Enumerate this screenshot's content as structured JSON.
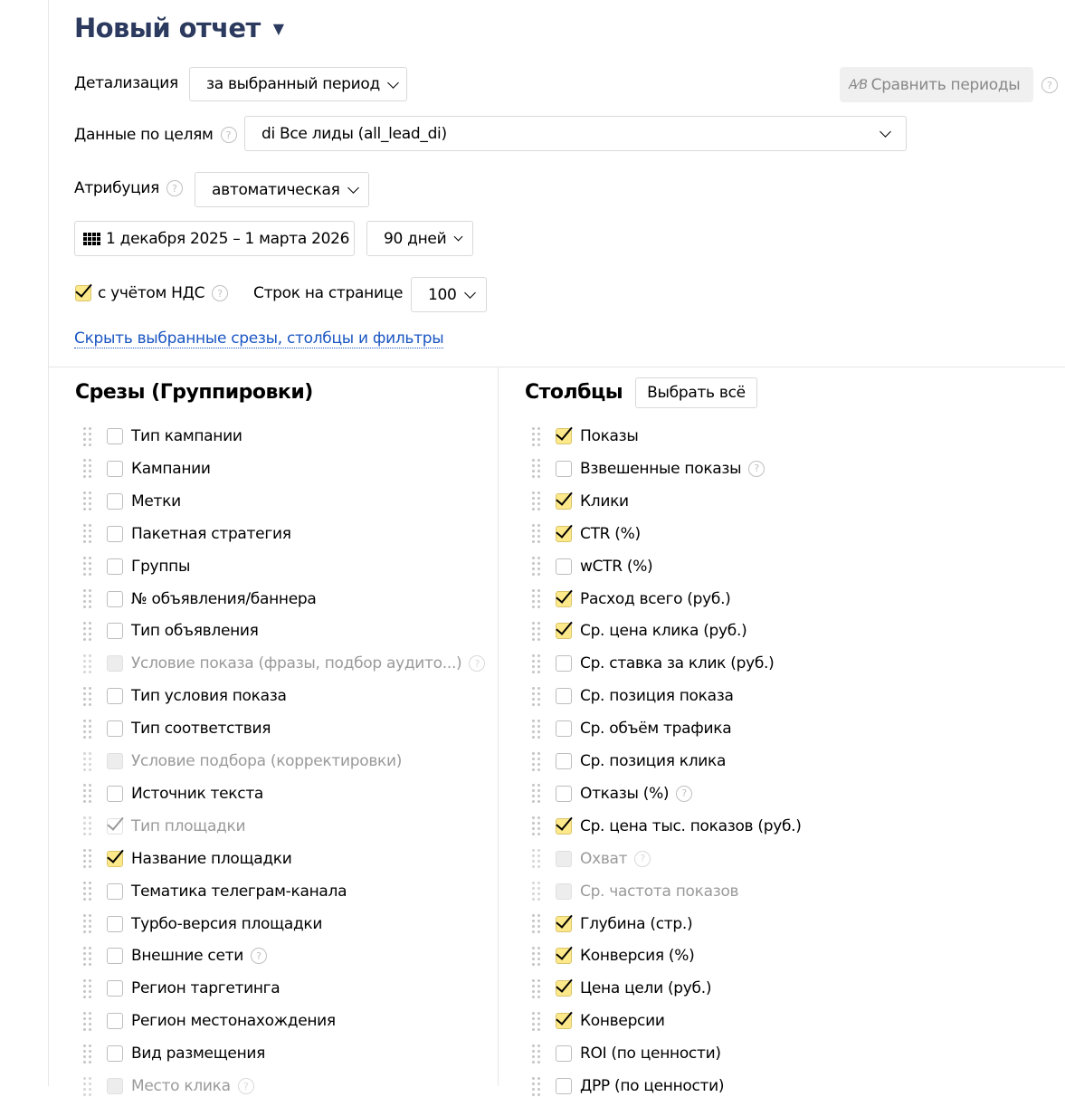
{
  "title": "Новый отчет",
  "detail": {
    "label": "Детализация",
    "value": "за выбранный период"
  },
  "compare_label": "Сравнить периоды",
  "goals": {
    "label": "Данные по целям",
    "value": "di Все лиды (all_lead_di)"
  },
  "attribution": {
    "label": "Атрибуция",
    "value": "автоматическая"
  },
  "period": {
    "dates": "1 декабря 2025 – 1 марта 2026",
    "days": "90 дней"
  },
  "vat": {
    "label": "с учётом НДС",
    "checked": true
  },
  "rows_per_page": {
    "label": "Строк на странице",
    "value": "100"
  },
  "hide_link": "Скрыть выбранные срезы, столбцы и фильтры",
  "slices": {
    "heading": "Срезы (Группировки)",
    "items": [
      {
        "label": "Тип кампании",
        "state": "off"
      },
      {
        "label": "Кампании",
        "state": "off"
      },
      {
        "label": "Метки",
        "state": "off"
      },
      {
        "label": "Пакетная стратегия",
        "state": "off"
      },
      {
        "label": "Группы",
        "state": "off"
      },
      {
        "label": "№ объявления/баннера",
        "state": "off"
      },
      {
        "label": "Тип объявления",
        "state": "off"
      },
      {
        "label": "Условие показа (фразы, подбор аудито...)",
        "state": "disabled",
        "help": true
      },
      {
        "label": "Тип условия показа",
        "state": "off"
      },
      {
        "label": "Тип соответствия",
        "state": "off"
      },
      {
        "label": "Условие подбора (корректировки)",
        "state": "disabled"
      },
      {
        "label": "Источник текста",
        "state": "off"
      },
      {
        "label": "Тип площадки",
        "state": "disabled-on"
      },
      {
        "label": "Название площадки",
        "state": "on"
      },
      {
        "label": "Тематика телеграм-канала",
        "state": "off"
      },
      {
        "label": "Турбо-версия площадки",
        "state": "off"
      },
      {
        "label": "Внешние сети",
        "state": "off",
        "help": true
      },
      {
        "label": "Регион таргетинга",
        "state": "off"
      },
      {
        "label": "Регион местонахождения",
        "state": "off"
      },
      {
        "label": "Вид размещения",
        "state": "off"
      },
      {
        "label": "Место клика",
        "state": "disabled",
        "help": true
      }
    ]
  },
  "columns": {
    "heading": "Столбцы",
    "select_all": "Выбрать всё",
    "items": [
      {
        "label": "Показы",
        "state": "on"
      },
      {
        "label": "Взвешенные показы",
        "state": "off",
        "help": true
      },
      {
        "label": "Клики",
        "state": "on"
      },
      {
        "label": "CTR (%)",
        "state": "on"
      },
      {
        "label": "wCTR (%)",
        "state": "off"
      },
      {
        "label": "Расход всего (руб.)",
        "state": "on"
      },
      {
        "label": "Ср. цена клика (руб.)",
        "state": "on"
      },
      {
        "label": "Ср. ставка за клик (руб.)",
        "state": "off"
      },
      {
        "label": "Ср. позиция показа",
        "state": "off"
      },
      {
        "label": "Ср. объём трафика",
        "state": "off"
      },
      {
        "label": "Ср. позиция клика",
        "state": "off"
      },
      {
        "label": "Отказы (%)",
        "state": "off",
        "help": true
      },
      {
        "label": "Ср. цена тыс. показов (руб.)",
        "state": "on"
      },
      {
        "label": "Охват",
        "state": "disabled",
        "help": true
      },
      {
        "label": "Ср. частота показов",
        "state": "disabled"
      },
      {
        "label": "Глубина (стр.)",
        "state": "on"
      },
      {
        "label": "Конверсия (%)",
        "state": "on"
      },
      {
        "label": "Цена цели (руб.)",
        "state": "on"
      },
      {
        "label": "Конверсии",
        "state": "on"
      },
      {
        "label": "ROI (по ценности)",
        "state": "off"
      },
      {
        "label": "ДРР (по ценности)",
        "state": "off"
      }
    ]
  },
  "help_glyph": "?"
}
